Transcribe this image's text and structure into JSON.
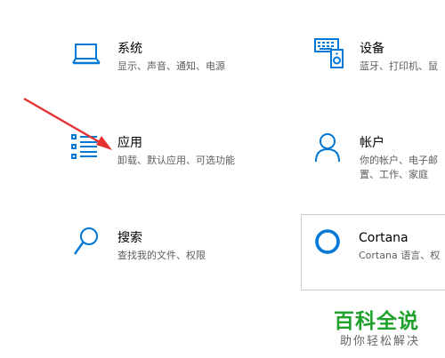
{
  "tiles": {
    "system": {
      "title": "系统",
      "desc": "显示、声音、通知、电源",
      "icon": "laptop-icon"
    },
    "devices": {
      "title": "设备",
      "desc": "蓝牙、打印机、鼠",
      "icon": "devices-icon"
    },
    "apps": {
      "title": "应用",
      "desc": "卸载、默认应用、可选功能",
      "icon": "apps-list-icon"
    },
    "accounts": {
      "title": "帐户",
      "desc": "你的帐户、电子邮",
      "desc2": "置、工作、家庭",
      "icon": "person-icon"
    },
    "search": {
      "title": "搜索",
      "desc": "查找我的文件、权限",
      "icon": "search-icon"
    },
    "cortana": {
      "title": "Cortana",
      "desc": "Cortana 语言、权",
      "icon": "cortana-ring-icon"
    }
  },
  "watermark": {
    "main": "百科全说",
    "sub": "助你轻松解决"
  },
  "colors": {
    "accent": "#0078d7",
    "annotation_arrow": "#e53333",
    "watermark_green": "#1fa12c"
  }
}
